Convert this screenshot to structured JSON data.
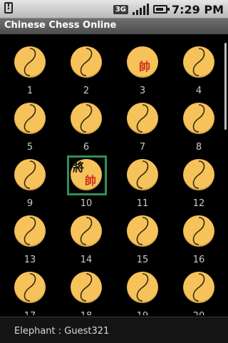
{
  "status_bar": {
    "network_label": "3G",
    "time": "7:29 PM",
    "icons": [
      "warning-icon",
      "signal-icon",
      "battery-icon"
    ]
  },
  "app": {
    "title": "Chinese Chess Online"
  },
  "tables": [
    {
      "number": "1",
      "seats": []
    },
    {
      "number": "2",
      "seats": []
    },
    {
      "number": "3",
      "seats": [
        "帥"
      ]
    },
    {
      "number": "4",
      "seats": []
    },
    {
      "number": "5",
      "seats": []
    },
    {
      "number": "6",
      "seats": []
    },
    {
      "number": "7",
      "seats": []
    },
    {
      "number": "8",
      "seats": []
    },
    {
      "number": "9",
      "seats": []
    },
    {
      "number": "10",
      "seats": [
        "將",
        "帥"
      ],
      "selected": true
    },
    {
      "number": "11",
      "seats": []
    },
    {
      "number": "12",
      "seats": []
    },
    {
      "number": "13",
      "seats": []
    },
    {
      "number": "14",
      "seats": []
    },
    {
      "number": "15",
      "seats": []
    },
    {
      "number": "16",
      "seats": []
    },
    {
      "number": "17",
      "seats": []
    },
    {
      "number": "18",
      "seats": []
    },
    {
      "number": "19",
      "seats": []
    },
    {
      "number": "20",
      "seats": []
    }
  ],
  "footer": {
    "player_text": "Elephant : Guest321"
  },
  "colors": {
    "table_fill": "#f6c25a",
    "selected_frame": "#2f8f5a",
    "red_piece": "#d1301f",
    "black_piece": "#111111"
  }
}
